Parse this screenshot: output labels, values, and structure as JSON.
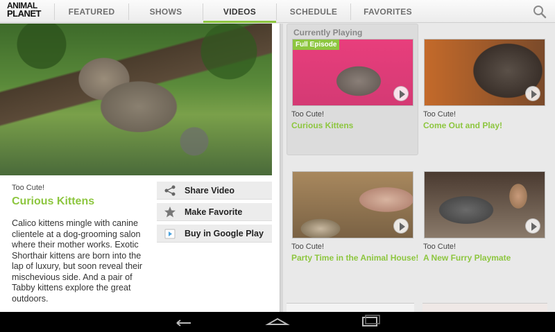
{
  "logo": {
    "line1": "ANIMAL",
    "line2": "PLANET"
  },
  "tabs": [
    {
      "label": "FEATURED",
      "active": false
    },
    {
      "label": "SHOWS",
      "active": false
    },
    {
      "label": "VIDEOS",
      "active": true
    },
    {
      "label": "SCHEDULE",
      "active": false
    },
    {
      "label": "FAVORITES",
      "active": false
    }
  ],
  "accent_color": "#8dc63f",
  "detail": {
    "show": "Too Cute!",
    "title": "Curious Kittens",
    "description": "Calico kittens mingle with canine clientele at a dog-grooming salon where their mother works. Exotic Shorthair kittens are born into the lap of luxury, but soon reveal their mischevious side. And a pair of Tabby kittens explore the great outdoors."
  },
  "actions": [
    {
      "label": "Share Video",
      "icon": "share-icon"
    },
    {
      "label": "Make Favorite",
      "icon": "star-icon"
    },
    {
      "label": "Buy in Google Play",
      "icon": "google-play-icon"
    }
  ],
  "current_label": "Currently Playing",
  "videos": [
    {
      "show": "Too Cute!",
      "title": "Curious Kittens",
      "badge": "Full Episode"
    },
    {
      "show": "Too Cute!",
      "title": "Come Out and Play!",
      "badge": ""
    },
    {
      "show": "Too Cute!",
      "title": "Party Time in the Animal House!",
      "badge": ""
    },
    {
      "show": "Too Cute!",
      "title": "A New Furry Playmate",
      "badge": ""
    }
  ]
}
